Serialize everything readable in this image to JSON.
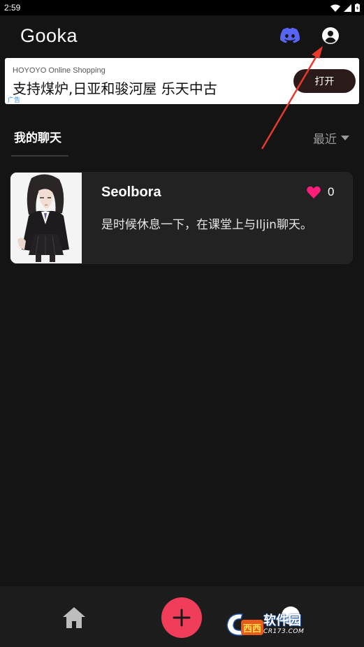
{
  "status_bar": {
    "time": "2:59"
  },
  "header": {
    "app_title": "Gooka",
    "discord_icon": "discord-icon",
    "profile_icon": "profile-icon"
  },
  "ad": {
    "source": "HOYOYO Online Shopping",
    "headline": "支持煤炉,日亚和骏河屋 乐天中古",
    "label": "广告",
    "button_label": "打开"
  },
  "tabs": {
    "my_chats": "我的聊天",
    "sort_label": "最近"
  },
  "chats": [
    {
      "name": "Seolbora",
      "likes": "0",
      "preview": "是时候休息一下，在课堂上与Iljin聊天。"
    }
  ],
  "nav": {
    "home_icon": "home-icon",
    "add_icon": "plus-icon"
  },
  "watermark": {
    "logo_text": "西西",
    "text": "软件园",
    "sub": "CR173.COM"
  },
  "colors": {
    "background": "#141414",
    "card": "#222222",
    "accent": "#f03e5a",
    "heart": "#ff1f7a",
    "discord": "#5865f2",
    "annotation": "#e8392c"
  }
}
